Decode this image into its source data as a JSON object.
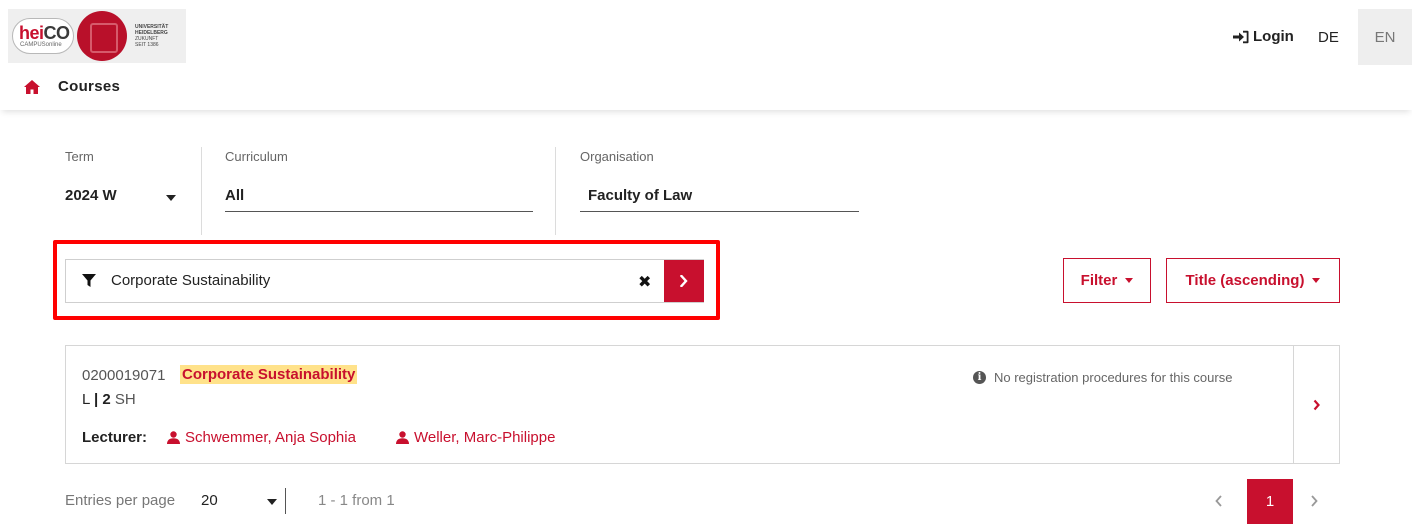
{
  "header": {
    "logo": {
      "heico_text": "hei",
      "heico_co": "CO",
      "heico_sub": "CAMPUSonline",
      "uni_lines": [
        "UNIVERSITÄT",
        "HEIDELBERG",
        "ZUKUNFT",
        "SEIT 1386"
      ]
    },
    "login_label": "Login",
    "lang_de": "DE",
    "lang_en": "EN",
    "breadcrumb_title": "Courses"
  },
  "filters": {
    "term_label": "Term",
    "term_value": "2024 W",
    "curriculum_label": "Curriculum",
    "curriculum_value": "All",
    "organisation_label": "Organisation",
    "organisation_value": "Faculty of Law"
  },
  "search": {
    "value": "Corporate Sustainability",
    "clear_symbol": "✖"
  },
  "buttons": {
    "filter_label": "Filter",
    "sort_label": "Title (ascending)"
  },
  "results": [
    {
      "code": "0200019071",
      "title": "Corporate Sustainability",
      "type": "L",
      "hours": "2",
      "hours_unit": "SH",
      "registration_note": "No registration procedures for this course",
      "lecturer_label": "Lecturer:",
      "lecturers": [
        "Schwemmer, Anja Sophia",
        "Weller, Marc-Philippe"
      ]
    }
  ],
  "footer": {
    "entries_label": "Entries per page",
    "entries_value": "20",
    "range_text": "1 - 1 from 1",
    "current_page": "1"
  },
  "colors": {
    "accent": "#c8102e",
    "highlight": "#ffe28a",
    "annotation": "#ff0000"
  }
}
